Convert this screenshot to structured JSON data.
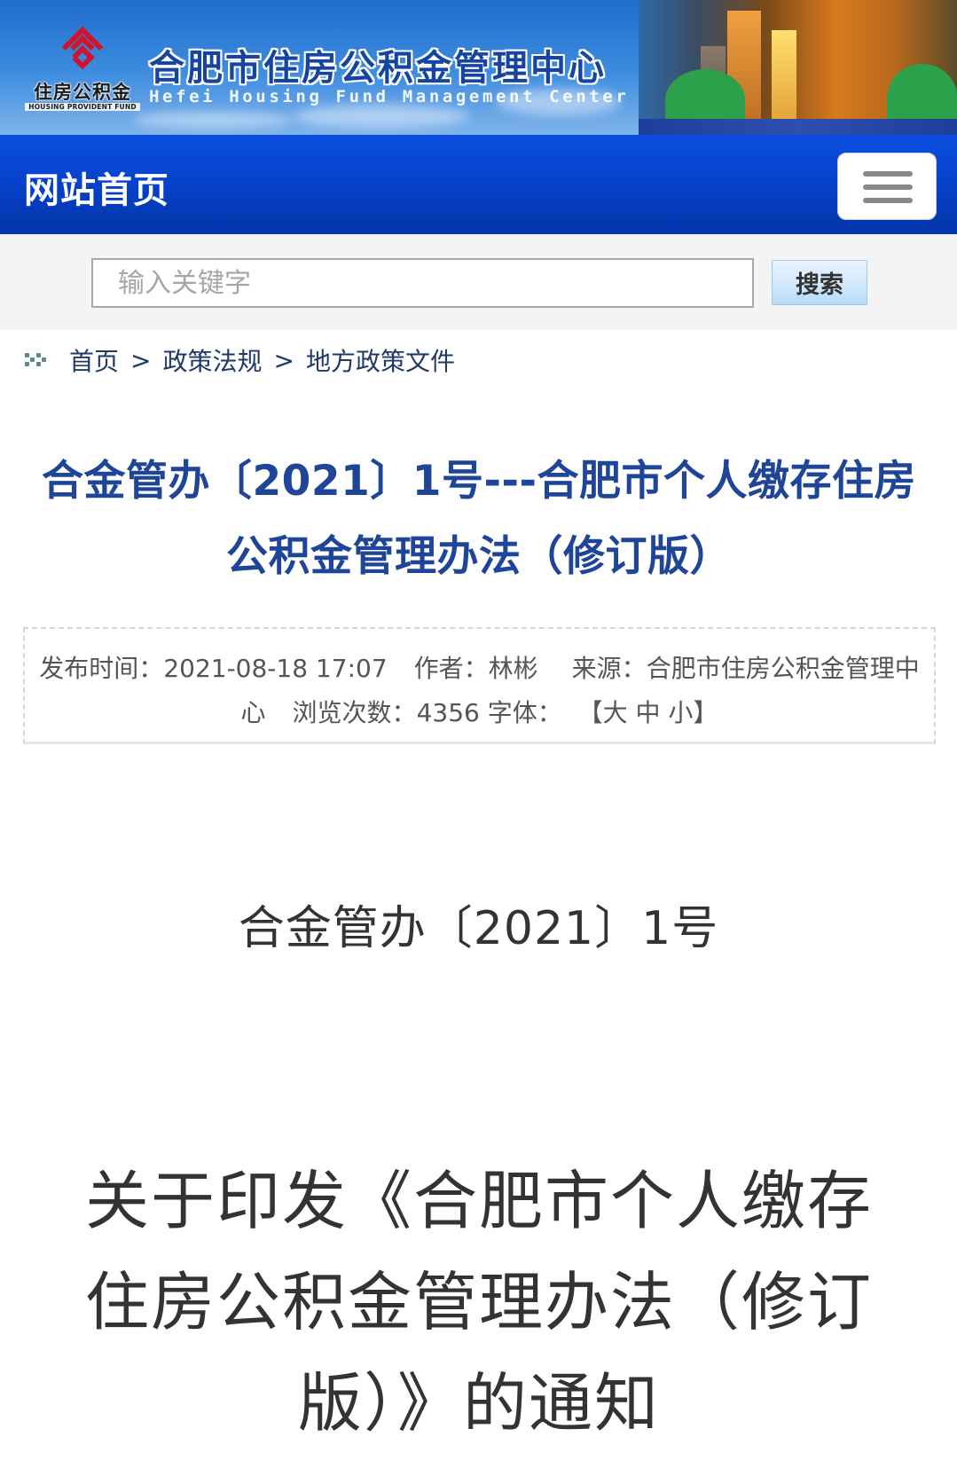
{
  "banner": {
    "logo_cn": "住房公积金",
    "logo_en": "HOUSING PROVIDENT FUND",
    "title": "合肥市住房公积金管理中心",
    "subtitle": "Hefei Housing Fund Management Center",
    "logo_color": "#d0142c"
  },
  "navbar": {
    "home_label": "网站首页",
    "menu_icon": "hamburger-menu-icon"
  },
  "search": {
    "placeholder": "输入关键字",
    "value": "",
    "button_label": "搜索"
  },
  "breadcrumb": {
    "icon": "double-chevron-icon",
    "items": [
      "首页",
      "政策法规",
      "地方政策文件"
    ],
    "separator": ">"
  },
  "article": {
    "title": "合金管办〔2021〕1号---合肥市个人缴存住房公积金管理办法（修订版）",
    "title_color": "#1f4598",
    "meta": {
      "publish_label": "发布时间：",
      "publish_time": "2021-08-18 17:07",
      "author_label": "作者：",
      "author": "林彬",
      "source_label": "来源：",
      "source": "合肥市住房公积金管理中心",
      "views_label": "浏览次数：",
      "views": "4356",
      "font_label": "字体：",
      "font_open": "【",
      "font_sizes": [
        "大",
        "中",
        "小"
      ],
      "font_close": "】"
    },
    "doc_number": "合金管办〔2021〕1号",
    "doc_heading": "关于印发《合肥市个人缴存住房公积金管理办法（修订版）》的通知"
  }
}
